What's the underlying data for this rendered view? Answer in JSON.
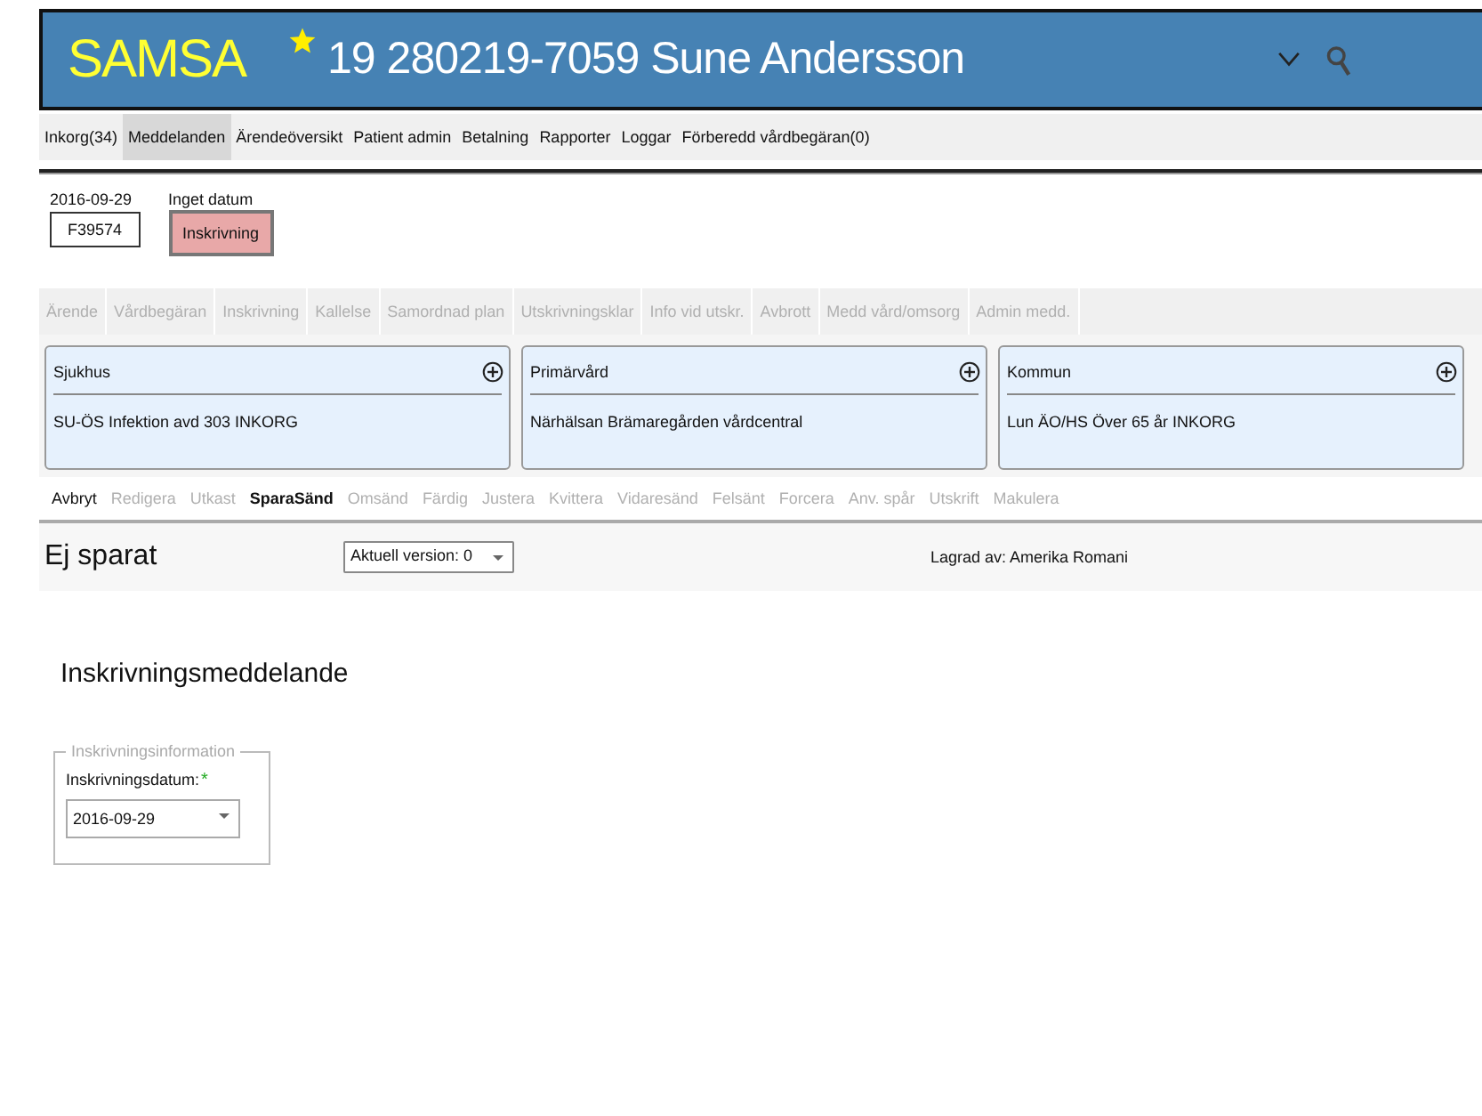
{
  "header": {
    "logo": "SAMSA",
    "starred": true,
    "patient": "19 280219-7059 Sune Andersson"
  },
  "nav": [
    {
      "label": "Inkorg(34)",
      "selected": false
    },
    {
      "label": "Meddelanden",
      "selected": true
    },
    {
      "label": "Ärendeöversikt",
      "selected": false
    },
    {
      "label": "Patient admin",
      "selected": false
    },
    {
      "label": "Betalning",
      "selected": false
    },
    {
      "label": "Rapporter",
      "selected": false
    },
    {
      "label": "Loggar",
      "selected": false
    },
    {
      "label": "Förberedd vårdbegäran(0)",
      "selected": false
    }
  ],
  "case": {
    "date": "2016-09-29",
    "id": "F39574",
    "status_date": "Inget datum",
    "status": "Inskrivning"
  },
  "steps": [
    {
      "label": "Ärende",
      "disabled": true
    },
    {
      "label": "Vårdbegäran",
      "disabled": true
    },
    {
      "label": "Inskrivning",
      "disabled": true
    },
    {
      "label": "Kallelse",
      "disabled": true
    },
    {
      "label": "Samordnad plan",
      "disabled": true
    },
    {
      "label": "Utskrivningsklar",
      "disabled": true
    },
    {
      "label": "Info vid utskr.",
      "disabled": true
    },
    {
      "label": "Avbrott",
      "disabled": true
    },
    {
      "label": "Medd vård/omsorg",
      "disabled": true
    },
    {
      "label": "Admin medd.",
      "disabled": true
    }
  ],
  "cards": [
    {
      "title": "Sjukhus",
      "value": "SU-ÖS Infektion avd 303 INKORG"
    },
    {
      "title": "Primärvård",
      "value": "Närhälsan Brämaregården vårdcentral"
    },
    {
      "title": "Kommun",
      "value": "Lun ÄO/HS Över 65 år INKORG"
    }
  ],
  "actions": [
    {
      "label": "Avbryt",
      "disabled": false,
      "default": false
    },
    {
      "label": "Redigera",
      "disabled": true,
      "default": false
    },
    {
      "label": "Utkast",
      "disabled": true,
      "default": false
    },
    {
      "label": "SparaSänd",
      "disabled": false,
      "default": true
    },
    {
      "label": "Omsänd",
      "disabled": true,
      "default": false
    },
    {
      "label": "Färdig",
      "disabled": true,
      "default": false
    },
    {
      "label": "Justera",
      "disabled": true,
      "default": false
    },
    {
      "label": "Kvittera",
      "disabled": true,
      "default": false
    },
    {
      "label": "Vidaresänd",
      "disabled": true,
      "default": false
    },
    {
      "label": "Felsänt",
      "disabled": true,
      "default": false
    },
    {
      "label": "Forcera",
      "disabled": true,
      "default": false
    },
    {
      "label": "Anv. spår",
      "disabled": true,
      "default": false
    },
    {
      "label": "Utskrift",
      "disabled": true,
      "default": false
    },
    {
      "label": "Makulera",
      "disabled": true,
      "default": false
    }
  ],
  "save_status": "Ej sparat",
  "version": "Aktuell version: 0",
  "saved_by": "Lagrad av: Amerika Romani",
  "form": {
    "title": "Inskrivningsmeddelande",
    "legend": "Inskrivningsinformation",
    "field_label": "Inskrivningsdatum:",
    "required_mark": "*",
    "value": "2016-09-29"
  }
}
